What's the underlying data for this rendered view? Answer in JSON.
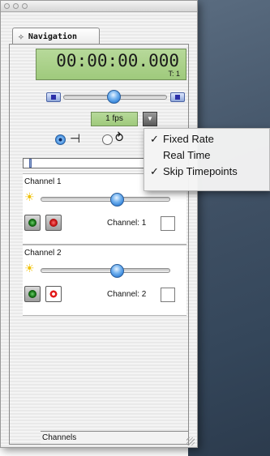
{
  "window": {
    "tab_label": "Navigation",
    "timecode": "00:00:00.000",
    "timepoint": "T: 1",
    "fps_value": "1 fps",
    "fps_dropdown_icon": "chevron-down-icon",
    "channels_footer": "Channels"
  },
  "channels": [
    {
      "title": "Channel 1",
      "label": "Channel: 1"
    },
    {
      "title": "Channel 2",
      "label": "Channel: 2"
    }
  ],
  "menu": {
    "items": [
      {
        "label": "Fixed Rate",
        "checked": true
      },
      {
        "label": "Real Time",
        "checked": false
      },
      {
        "label": "Skip Timepoints",
        "checked": true
      }
    ]
  }
}
